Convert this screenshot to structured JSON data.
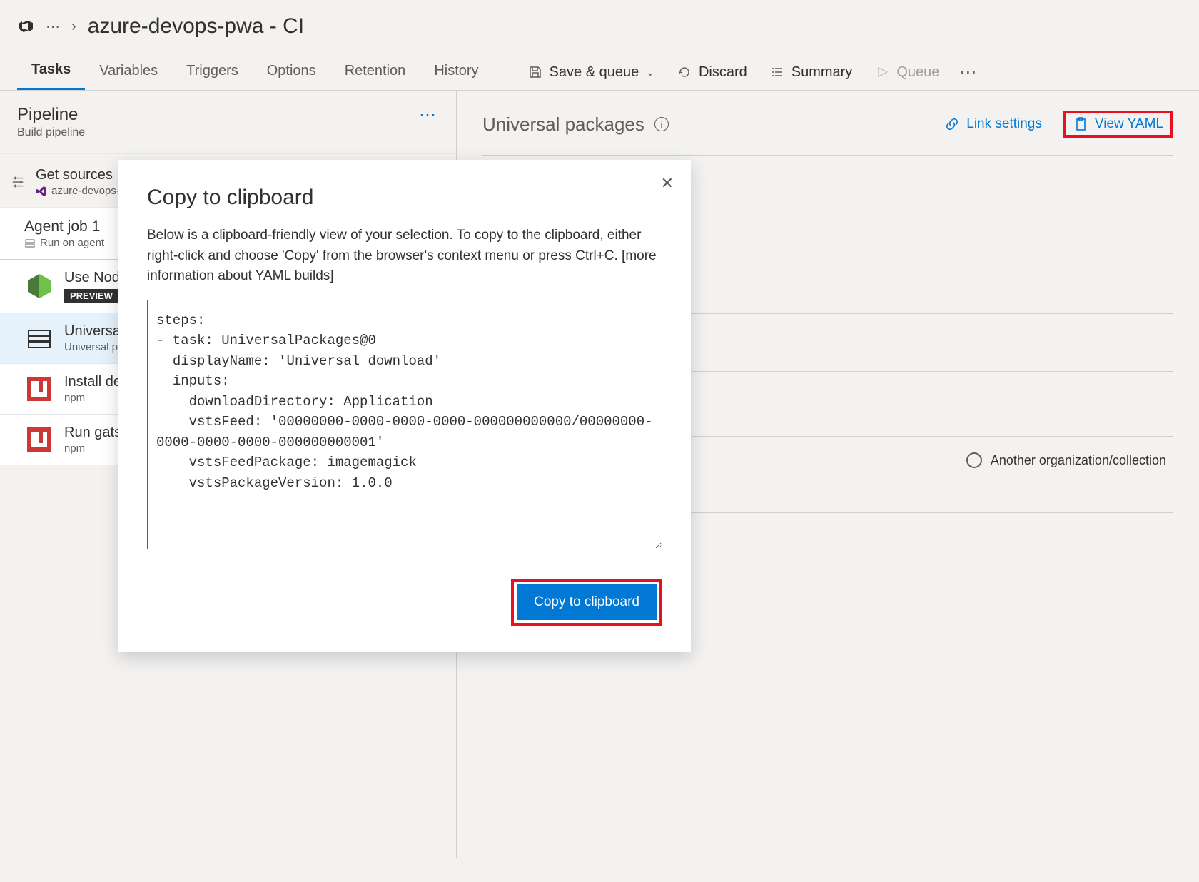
{
  "breadcrumb": {
    "ellipsis": "⋯",
    "chevron": "›",
    "title": "azure-devops-pwa - CI"
  },
  "tabs": {
    "tasks": "Tasks",
    "variables": "Variables",
    "triggers": "Triggers",
    "options": "Options",
    "retention": "Retention",
    "history": "History"
  },
  "toolbar": {
    "save_queue": "Save & queue",
    "discard": "Discard",
    "summary": "Summary",
    "queue": "Queue",
    "more": "⋯"
  },
  "pipeline": {
    "title": "Pipeline",
    "subtitle": "Build pipeline",
    "more": "⋯"
  },
  "tree": {
    "get_sources": {
      "title": "Get sources",
      "subtitle": "azure-devops-"
    },
    "agent_job": {
      "title": "Agent job 1",
      "subtitle": "Run on agent"
    },
    "tasks": {
      "use_node": {
        "title": "Use Nod",
        "preview": "PREVIEW"
      },
      "universal": {
        "title": "Universal",
        "subtitle": "Universal pa"
      },
      "install_de": {
        "title": "Install de",
        "subtitle": "npm"
      },
      "run_gats": {
        "title": "Run gats",
        "subtitle": "npm"
      }
    }
  },
  "rightPanel": {
    "title": "Universal packages",
    "link_settings": "Link settings",
    "view_yaml": "View YAML",
    "radio_label": "Another organization/collection"
  },
  "modal": {
    "title": "Copy to clipboard",
    "description": "Below is a clipboard-friendly view of your selection. To copy to the clipboard, either right-click and choose 'Copy' from the browser's context menu or press Ctrl+C. [more information about YAML builds]",
    "yaml": "steps:\n- task: UniversalPackages@0\n  displayName: 'Universal download'\n  inputs:\n    downloadDirectory: Application\n    vstsFeed: '00000000-0000-0000-0000-000000000000/00000000-0000-0000-0000-000000000001'\n    vstsFeedPackage: imagemagick\n    vstsPackageVersion: 1.0.0\n",
    "copy_button": "Copy to clipboard"
  }
}
